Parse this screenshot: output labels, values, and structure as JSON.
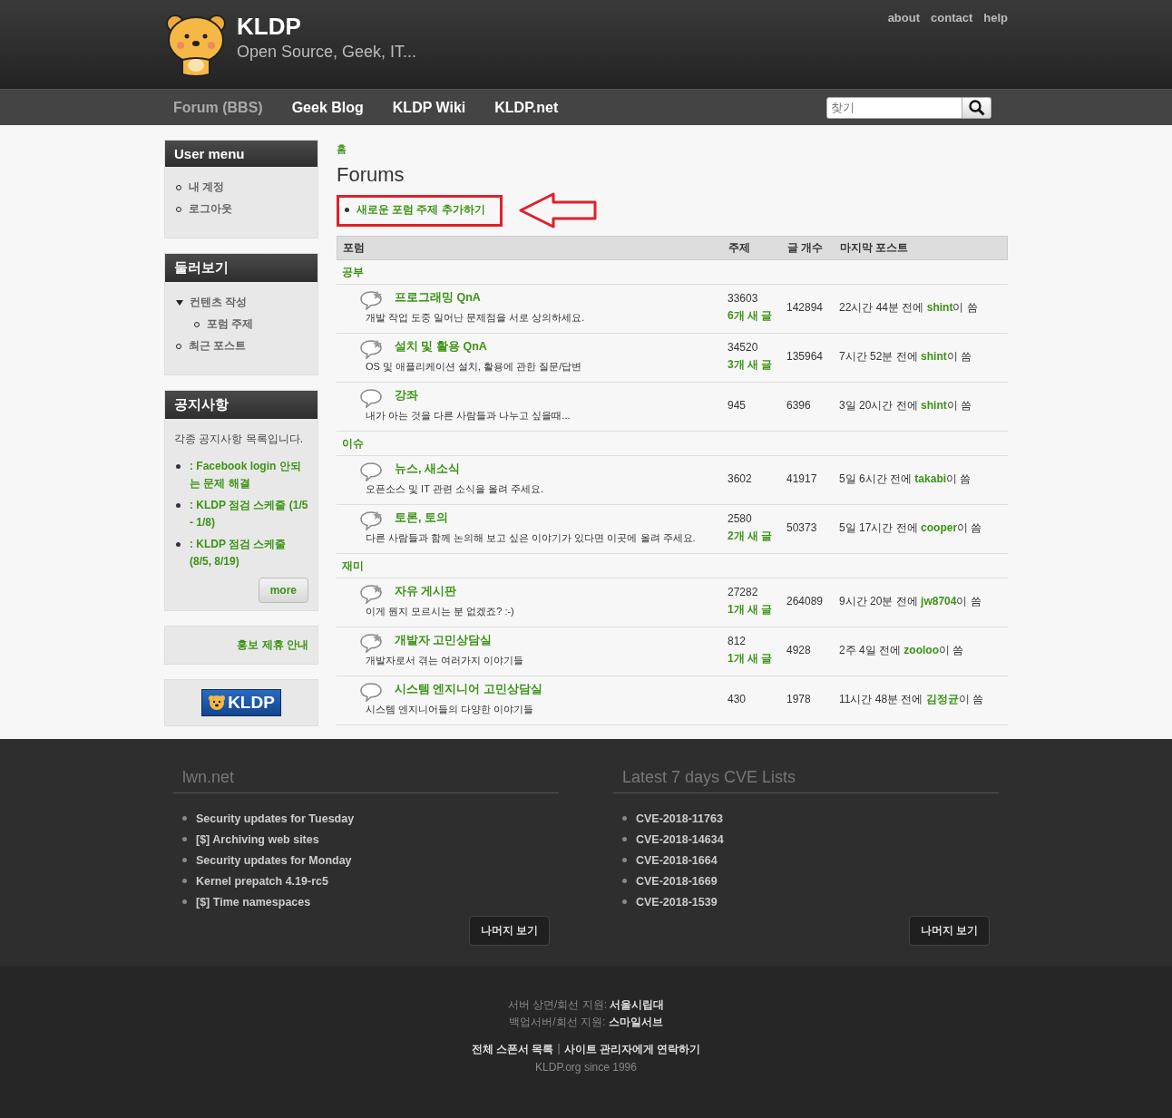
{
  "site": {
    "title": "KLDP",
    "slogan": "Open Source, Geek, IT..."
  },
  "top_links": [
    "about",
    "contact",
    "help"
  ],
  "nav": [
    {
      "label": "Forum (BBS)",
      "selected": true
    },
    {
      "label": "Geek Blog",
      "selected": false
    },
    {
      "label": "KLDP Wiki",
      "selected": false
    },
    {
      "label": "KLDP.net",
      "selected": false
    }
  ],
  "search": {
    "placeholder": "찾기"
  },
  "sidebar": {
    "user_menu": {
      "title": "User menu",
      "items": [
        "내 계정",
        "로그아웃"
      ]
    },
    "browse": {
      "title": "둘러보기",
      "items": [
        {
          "label": "컨텐츠 작성",
          "expanded": true,
          "children": [
            {
              "label": "포럼 주제"
            }
          ]
        },
        {
          "label": "최근 포스트",
          "expanded": false
        }
      ]
    },
    "notices": {
      "title": "공지사항",
      "intro": "각종 공지사항 목록입니다.",
      "items": [
        ": Facebook login 안되는 문제 해결",
        ": KLDP 점검 스케줄 (1/5 - 1/8)",
        ": KLDP 점검 스케줄 (8/5, 8/19)"
      ],
      "more": "more"
    },
    "promo_link": "홍보 제휴 안내",
    "banner": "KLDP"
  },
  "breadcrumb": "홈",
  "page_title": "Forums",
  "action": {
    "label": "새로운 포럼 주제 추가하기",
    "highlighted": true
  },
  "table": {
    "columns": [
      "포럼",
      "주제",
      "글 개수",
      "마지막 포스트"
    ],
    "groups": [
      {
        "name": "공부",
        "forums": [
          {
            "name": "프로그래밍 QnA",
            "description": "개발 작업 도중 일어난 문제점을 서로 상의하세요.",
            "has_new": true,
            "topics": "33603",
            "new_posts": "6개 새 글",
            "posts": "142894",
            "last_time": "22시간 44분 전에",
            "last_user": "shint",
            "last_suffix": "이 씀"
          },
          {
            "name": "설치 및 활용 QnA",
            "description": "OS 및 애플리케이션 설치, 활용에 관한 질문/답변",
            "has_new": true,
            "topics": "34520",
            "new_posts": "3개 새 글",
            "posts": "135964",
            "last_time": "7시간 52분 전에",
            "last_user": "shint",
            "last_suffix": "이 씀"
          },
          {
            "name": "강좌",
            "description": "내가 아는 것을 다른 사람들과 나누고 싶을때...",
            "has_new": false,
            "topics": "945",
            "posts": "6396",
            "last_time": "3일 20시간 전에",
            "last_user": "shint",
            "last_suffix": "이 씀"
          }
        ]
      },
      {
        "name": "이슈",
        "forums": [
          {
            "name": "뉴스, 새소식",
            "description": "오픈소스 및 IT 관련 소식을 올려 주세요.",
            "has_new": false,
            "topics": "3602",
            "posts": "41917",
            "last_time": "5일 6시간 전에",
            "last_user": "takabi",
            "last_suffix": "이 씀"
          },
          {
            "name": "토론, 토의",
            "description": "다른 사람들과 함께 논의해 보고 싶은 이야기가 있다면 이곳에 올려 주세요.",
            "has_new": true,
            "topics": "2580",
            "new_posts": "2개 새 글",
            "posts": "50373",
            "last_time": "5일 17시간 전에",
            "last_user": "cooper",
            "last_suffix": "이 씀"
          }
        ]
      },
      {
        "name": "재미",
        "forums": [
          {
            "name": "자유 게시판",
            "description": "이게 뭔지 모르시는 분 없겠죠? :-)",
            "has_new": true,
            "topics": "27282",
            "new_posts": "1개 새 글",
            "posts": "264089",
            "last_time": "9시간 20분 전에",
            "last_user": "jw8704",
            "last_suffix": "이 씀"
          },
          {
            "name": "개발자 고민상담실",
            "description": "개발자로서 겪는 여러가지 이야기들",
            "has_new": true,
            "topics": "812",
            "new_posts": "1개 새 글",
            "posts": "4928",
            "last_time": "2주 4일 전에",
            "last_user": "zooloo",
            "last_suffix": "이 씀"
          },
          {
            "name": "시스템 엔지니어 고민상담실",
            "description": "시스템 엔지니어들의 다양한 이야기들",
            "has_new": false,
            "topics": "430",
            "posts": "1978",
            "last_time": "11시간 48분 전에",
            "last_user": "김정균",
            "last_suffix": "이 씀"
          }
        ]
      }
    ]
  },
  "footer_blocks": [
    {
      "title": "lwn.net",
      "items": [
        "Security updates for Tuesday",
        "[$] Archiving web sites",
        "Security updates for Monday",
        "Kernel prepatch 4.19-rc5",
        "[$] Time namespaces"
      ],
      "more": "나머지 보기"
    },
    {
      "title": "Latest 7 days CVE Lists",
      "items": [
        "CVE-2018-11763",
        "CVE-2018-14634",
        "CVE-2018-1664",
        "CVE-2018-1669",
        "CVE-2018-1539"
      ],
      "more": "나머지 보기"
    }
  ],
  "credits": [
    "서버 상면/회선 지원: **서울시립대**",
    "백업서버/회선 지원: **스마일서브**"
  ],
  "bottom_links": [
    "전체 스폰서 목록",
    "|",
    "사이트 관리자에게 연락하기"
  ],
  "since": "KLDP.org since 1996"
}
